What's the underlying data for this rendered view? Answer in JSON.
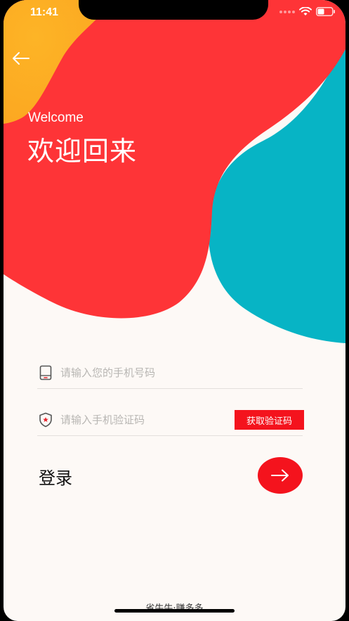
{
  "status_bar": {
    "time": "11:41"
  },
  "header": {
    "welcome_en": "Welcome",
    "welcome_cn": "欢迎回来"
  },
  "form": {
    "phone_placeholder": "请输入您的手机号码",
    "code_placeholder": "请输入手机验证码",
    "get_code_label": "获取验证码",
    "login_label": "登录"
  },
  "footer": {
    "text": "省牛牛·赚多多"
  },
  "colors": {
    "red": "#fe3437",
    "orange": "#fdad23",
    "teal": "#07b4c5",
    "accent": "#f4131d",
    "background": "#fdf9f6"
  },
  "icons": {
    "back": "arrow-left-icon",
    "phone": "tablet-icon",
    "code": "shield-icon",
    "login": "arrow-right-icon"
  }
}
